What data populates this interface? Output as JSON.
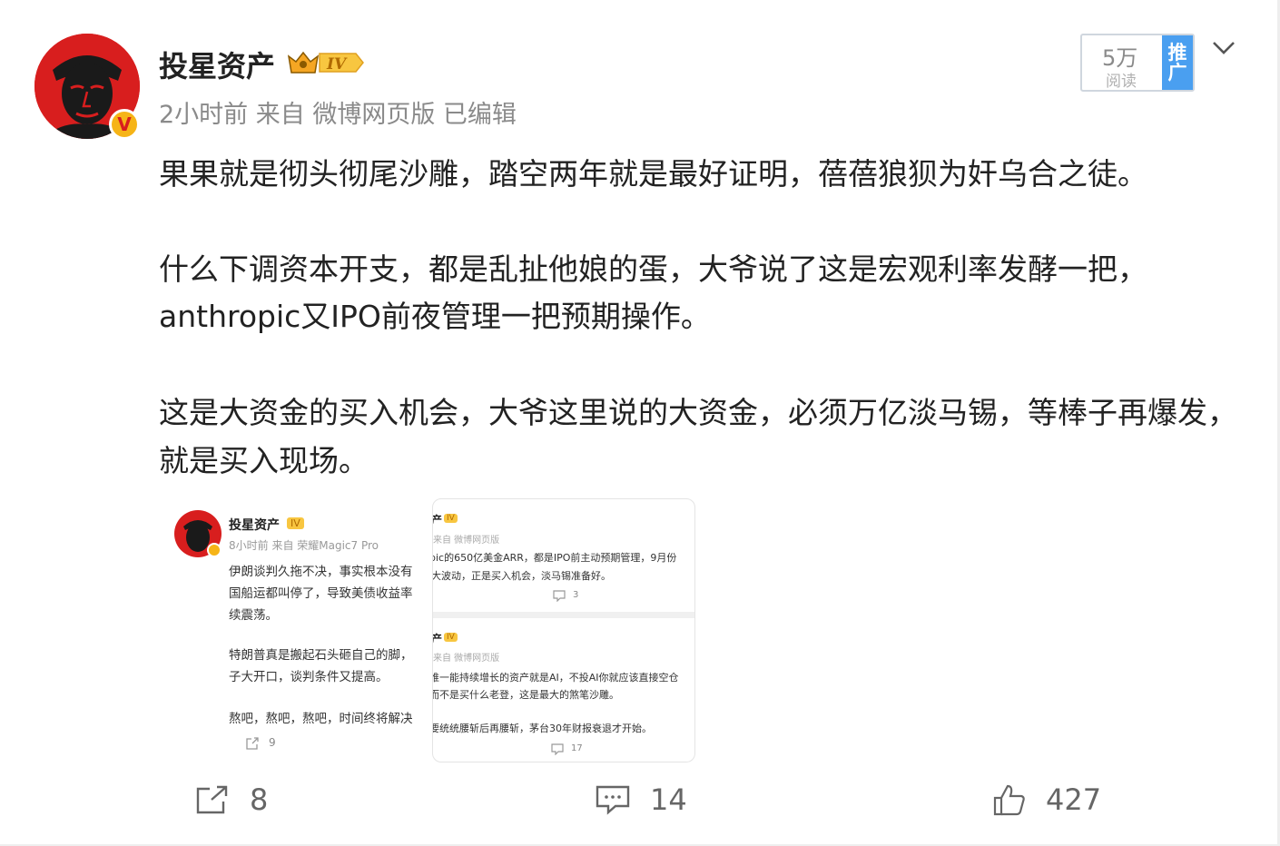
{
  "author": {
    "name": "投星资产",
    "level": "IV",
    "verified_mark": "V",
    "meta": "2小时前  来自 微博网页版 已编辑"
  },
  "views": {
    "count": "5万",
    "label": "阅读",
    "promo": "推广"
  },
  "post_lines": [
    "果果就是彻头彻尾沙雕，踏空两年就是最好证明，蓓蓓狼狈为奸乌合之徒。",
    "什么下调资本开支，都是乱扯他娘的蛋，大爷说了这是宏观利率发酵一把，",
    "anthropic又IPO前夜管理一把预期操作。",
    "这是大资金的买入机会，大爷这里说的大资金，必须万亿淡马锡，等棒子再爆发，",
    "就是买入现场。"
  ],
  "image1": {
    "name": "投星资产",
    "level": "IV",
    "meta": "8小时前  来自 荣耀Magic7 Pro",
    "lines": [
      "伊朗谈判久拖不决，事实根本没有",
      "国船运都叫停了，导致美债收益率",
      "续震荡。",
      "特朗普真是搬起石头砸自己的脚，",
      "子大开口，谈判条件又提高。",
      "熬吧，熬吧，熬吧，时间终将解决"
    ],
    "share_count": "9"
  },
  "image2": {
    "top": {
      "name": "产",
      "level": "IV",
      "meta": "来自 微博网页版",
      "lines": [
        "pic的650亿美金ARR，都是IPO前主动预期管理，9月份",
        "大波动，正是买入机会，淡马锡准备好。"
      ],
      "comment_count": "3"
    },
    "bottom": {
      "name": "产",
      "level": "IV",
      "meta": "来自 微博网页版",
      "lines": [
        "唯一能持续增长的资产就是AI，不投AI你就应该直接空仓",
        "而不是买什么老登，这是最大的煞笔沙雕。",
        "要统统腰斩后再腰斩，茅台30年财报衰退才开始。"
      ],
      "comment_count": "17"
    }
  },
  "actions": {
    "share": "8",
    "comment": "14",
    "like": "427"
  },
  "colors": {
    "accent": "#4a9ff0",
    "avatar_red": "#d81e1e",
    "badge_gold": "#f6b417"
  }
}
